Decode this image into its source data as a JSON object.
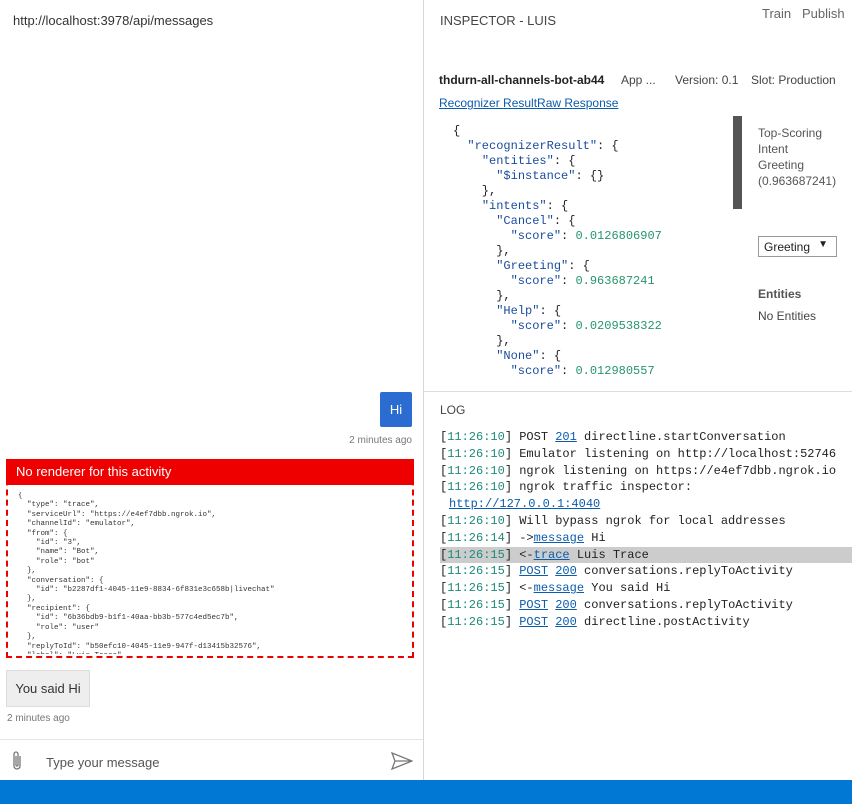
{
  "chat": {
    "url": "http://localhost:3978/api/messages",
    "user_message": "Hi",
    "user_timestamp": "2 minutes ago",
    "error_title": "No renderer for this activity",
    "activity_json": "{\n  \"type\": \"trace\",\n  \"serviceUrl\": \"https://e4ef7dbb.ngrok.io\",\n  \"channelId\": \"emulator\",\n  \"from\": {\n    \"id\": \"3\",\n    \"name\": \"Bot\",\n    \"role\": \"bot\"\n  },\n  \"conversation\": {\n    \"id\": \"b2287df1-4045-11e9-8834-6f831e3c658b|livechat\"\n  },\n  \"recipient\": {\n    \"id\": \"6b36bdb9-b1f1-40aa-bb3b-577c4ed5ec7b\",\n    \"role\": \"user\"\n  },\n  \"replyToId\": \"b50efc10-4045-11e9-947f-d13415b32576\",\n  \"label\": \"Luis Trace\",",
    "bot_message": "You said Hi",
    "bot_timestamp": "2 minutes ago",
    "input_placeholder": "Type your message"
  },
  "inspector": {
    "title": "INSPECTOR - LUIS",
    "train_label": "Train",
    "publish_label": "Publish",
    "bot_name": "thdurn-all-channels-bot-ab44",
    "app_label": "App ...",
    "version": "Version: 0.1",
    "slot": "Slot: Production",
    "tab_recognizer": "Recognizer Result",
    "tab_raw": "Raw Response",
    "top_scoring_label": "Top-Scoring Intent",
    "top_intent": "Greeting",
    "top_score": "(0.963687241)",
    "intent_select": "Greeting",
    "entities_title": "Entities",
    "entities_value": "No Entities"
  },
  "log": {
    "title": "LOG",
    "entries": [
      {
        "time": "[11:26:10]",
        "pre": "POST ",
        "link": "201",
        "post": " directline.startConversation",
        "linked": false
      },
      {
        "time": "[11:26:10]",
        "pre": "Emulator listening on http://localhost:52746",
        "link": "",
        "post": "",
        "linked": false
      },
      {
        "time": "[11:26:10]",
        "pre": "ngrok listening on https://e4ef7dbb.ngrok.io",
        "link": "",
        "post": "",
        "linked": false
      },
      {
        "time": "[11:26:10]",
        "pre": "ngrok traffic inspector:",
        "link": "",
        "post": "",
        "linked": false
      },
      {
        "time": "",
        "pre": "",
        "link": "http://127.0.0.1:4040",
        "post": "",
        "linked": true
      },
      {
        "time": "[11:26:10]",
        "pre": "Will bypass ngrok for local addresses",
        "link": "",
        "post": "",
        "linked": false
      },
      {
        "time": "[11:26:14]",
        "pre": "->",
        "link": "message",
        "post": " Hi",
        "linked": true
      },
      {
        "time": "[11:26:15]",
        "pre": "<-",
        "link": "trace",
        "post": " Luis Trace",
        "linked": true
      },
      {
        "time": "[11:26:15]",
        "pre": "",
        "link": "POST",
        "post": " ",
        "link2": "200",
        "post2": " conversations.replyToActivity",
        "linked": true
      },
      {
        "time": "[11:26:15]",
        "pre": "<-",
        "link": "message",
        "post": " You said Hi",
        "linked": true
      },
      {
        "time": "[11:26:15]",
        "pre": "",
        "link": "POST",
        "post": " ",
        "link2": "200",
        "post2": " conversations.replyToActivity",
        "linked": true
      },
      {
        "time": "[11:26:15]",
        "pre": "",
        "link": "POST",
        "post": " ",
        "link2": "200",
        "post2": " directline.postActivity",
        "linked": true
      }
    ]
  }
}
